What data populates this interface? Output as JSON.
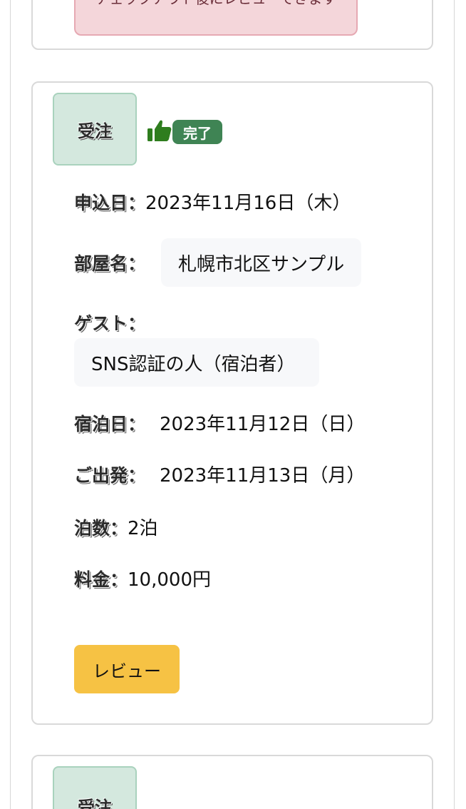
{
  "notice": {
    "text": "チェックアウト後にレビューできます"
  },
  "booking": {
    "status_label": "受注",
    "badge": "完了",
    "applied": {
      "label": "申込日：",
      "value": "2023年11月16日（木）"
    },
    "room": {
      "label": "部屋名：",
      "value": "札幌市北区サンプル"
    },
    "guest": {
      "label": "ゲスト：",
      "value": "SNS認証の人（宿泊者）"
    },
    "checkin": {
      "label": "宿泊日：",
      "value": "2023年11月12日（日）"
    },
    "checkout": {
      "label": "ご出発：",
      "value": "2023年11月13日（月）"
    },
    "nights": {
      "label": "泊数：",
      "value": "2泊"
    },
    "price": {
      "label": "料金：",
      "value": "10,000円"
    },
    "review_button": "レビュー"
  },
  "next_booking": {
    "status_label": "受注"
  },
  "colors": {
    "badge": "#3f8454",
    "review_button": "#f6c244",
    "status_box": "#d4e8de",
    "notice": "#f4d6da"
  },
  "icons": {
    "status_icon": "thumbs-up-icon"
  }
}
